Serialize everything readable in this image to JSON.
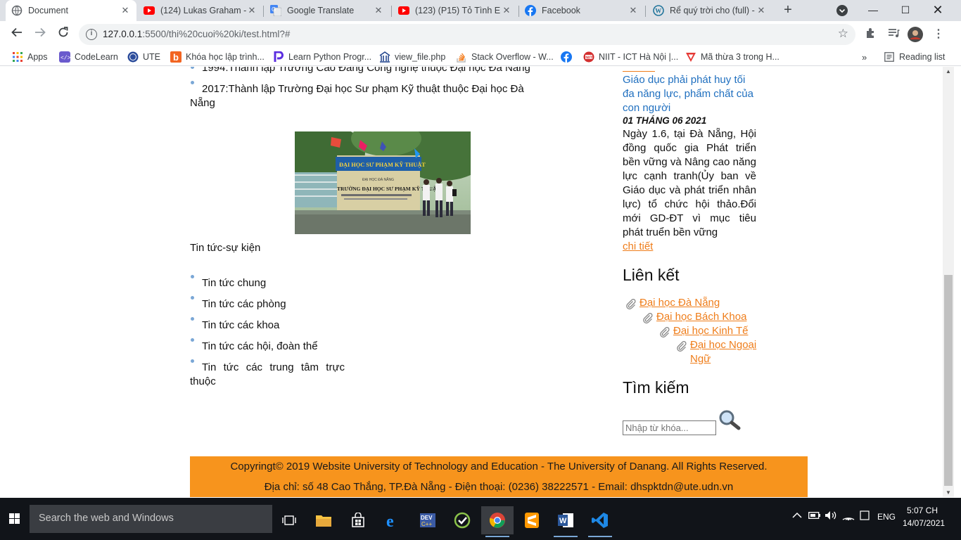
{
  "browser": {
    "tabs": [
      {
        "title": "Document",
        "icon": "globe-icon",
        "active": true
      },
      {
        "title": "(124) Lukas Graham -",
        "icon": "youtube-icon",
        "active": false
      },
      {
        "title": "Google Translate",
        "icon": "google-translate-icon",
        "active": false
      },
      {
        "title": "(123) (P15) Tỏ Tình Em",
        "icon": "youtube-icon",
        "active": false
      },
      {
        "title": "Facebook",
        "icon": "facebook-icon",
        "active": false
      },
      {
        "title": "Rể quý trời cho (full) -",
        "icon": "wordpress-icon",
        "active": false
      }
    ],
    "address": {
      "host": "127.0.0.1",
      "rest": ":5500/thi%20cuoi%20ki/test.html?#"
    },
    "bookmarks": [
      {
        "label": "Apps",
        "icon": "apps-grid-icon"
      },
      {
        "label": "CodeLearn",
        "icon": "codelearn-icon"
      },
      {
        "label": "UTE",
        "icon": "ute-icon"
      },
      {
        "label": "Khóa học lập trình...",
        "icon": "b-logo-icon"
      },
      {
        "label": "Learn Python Progr...",
        "icon": "p-logo-icon"
      },
      {
        "label": "view_file.php",
        "icon": "building-icon"
      },
      {
        "label": "Stack Overflow - W...",
        "icon": "stackoverflow-icon"
      },
      {
        "label": "",
        "icon": "facebook-icon"
      },
      {
        "label": "NIIT - ICT Hà Nội |...",
        "icon": "niit-icon"
      },
      {
        "label": "Mã thừa 3 trong H...",
        "icon": "v-logo-icon"
      }
    ],
    "reading_list": "Reading list"
  },
  "page": {
    "history_partial": "1994:Thành lập Trường Cao Đẳng Công nghệ thuộc Đại học Đà Nẵng",
    "history_2017_line1": "2017:Thành lập Trường Đại học Sư phạm Kỹ thuật thuộc Đại học Đà",
    "history_2017_line2": "Nẵng",
    "photo_sign_main": "ĐẠI HỌC SƯ PHẠM KỸ THUẬT",
    "photo_sign_sub": "ĐẠI HỌC ĐÀ NẴNG",
    "photo_sign_school": "TRƯỜNG ĐẠI HỌC SƯ PHẠM KỸ THUẬT",
    "news_heading": "Tin tức-sự kiện",
    "news_items": [
      "Tin tức chung",
      "Tin tức các phòng",
      "Tin tức các khoa",
      "Tin tức các hội, đoàn thể",
      "Tin tức các trung tâm trực"
    ],
    "news_item5_line2": "thuộc"
  },
  "sidebar": {
    "article_title_lines": [
      "Giáo dục phải phát huy tối",
      "đa năng lực, phẩm chất của",
      "con người"
    ],
    "article_date": "01 THÁNG 06 2021",
    "article_body_lines": [
      "Ngày 1.6, tại Đà Nẵng, Hội",
      "đồng quốc gia Phát triển",
      "bền vững và Nâng cao năng",
      "lực cạnh tranh(Ủy ban về",
      "Giáo dục và phát triển nhân",
      "lực) tổ chức hội thảo.Đổi",
      "mới GD-ĐT vì mục tiêu",
      "phát truển bền vững"
    ],
    "detail_link": "chi tiết",
    "links_heading": "Liên kết",
    "links": [
      "Đại học Đà Nẵng",
      "Đại học Bách Khoa",
      "Đại học Kinh Tế",
      "Đại học Ngoại"
    ],
    "link4_line2": "Ngữ",
    "search_heading": "Tìm kiếm",
    "search_placeholder": "Nhập từ khóa..."
  },
  "footer": {
    "copyright": "Copyringt© 2019 Website University of Technology and Education - The University of Danang. All Rights Reserved.",
    "contact": "Địa chỉ: số 48 Cao Thắng, TP.Đà Nẵng - Điện thoại: (0236) 38222571 - Email: dhspktdn@ute.udn.vn"
  },
  "taskbar": {
    "search_placeholder": "Search the web and Windows",
    "lang": "ENG",
    "time": "5:07 CH",
    "date": "14/07/2021"
  },
  "colors": {
    "footer_bg": "#f7941d",
    "link_orange": "#ef7d1a",
    "title_blue": "#1f6fbf"
  }
}
